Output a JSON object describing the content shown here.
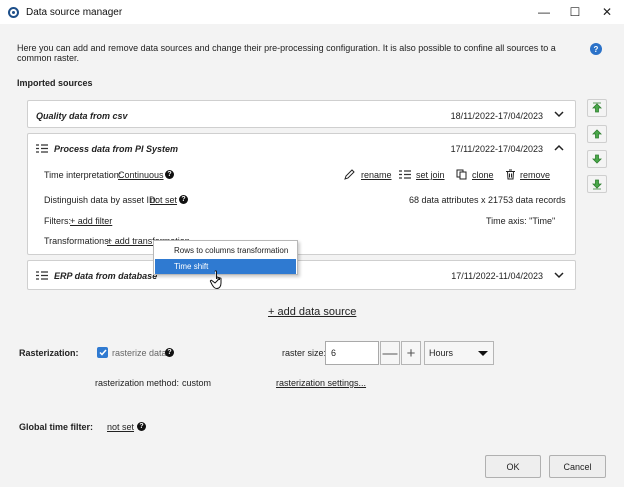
{
  "window": {
    "title": "Data source manager",
    "minimize_glyph": "—",
    "maximize_glyph": "☐",
    "close_glyph": "✕"
  },
  "intro": {
    "text": "Here you can add and remove data sources and change their pre-processing configuration. It is also possible to confine all sources to a common raster.",
    "help_glyph": "?"
  },
  "imported_sources_label": "Imported sources",
  "sources": [
    {
      "title": "Quality data from csv",
      "date_range": "18/11/2022-17/04/2023",
      "expanded": false
    },
    {
      "title": "Process data from PI System",
      "date_range": "17/11/2022-17/04/2023",
      "expanded": true,
      "time_interpretation_label": "Time interpretation:",
      "time_interpretation_value": "Continuous",
      "actions": {
        "rename": "rename",
        "set_join": "set join",
        "clone": "clone",
        "remove": "remove"
      },
      "asset_id_label": "Distinguish data by asset ID:",
      "asset_id_value": "not set",
      "records_info": "68 data attributes x 21753 data records",
      "filters_label": "Filters:",
      "add_filter": "+ add filter",
      "time_axis": "Time axis:  \"Time\"",
      "transformations_label": "Transformations:",
      "add_transformation": "+ add transformation"
    },
    {
      "title": "ERP data from database",
      "date_range": "17/11/2022-11/04/2023",
      "expanded": false
    }
  ],
  "context_menu": {
    "items": [
      {
        "label": "Rows to columns transformation",
        "highlighted": false
      },
      {
        "label": "Time shift",
        "highlighted": true
      }
    ]
  },
  "add_data_source": "+ add data source",
  "rasterization": {
    "label": "Rasterization:",
    "checkbox_label": "rasterize data",
    "checked": true,
    "raster_size_label": "raster size:",
    "raster_size_value": "6",
    "minus_glyph": "—",
    "plus_glyph": "+",
    "unit_selected": "Hours",
    "method_label": "rasterization method:",
    "method_value": "custom",
    "settings_link": "rasterization settings..."
  },
  "global_time_filter": {
    "label": "Global time filter:",
    "value": "not set"
  },
  "buttons": {
    "ok": "OK",
    "cancel": "Cancel"
  },
  "colors": {
    "accent": "#2f7ad1",
    "arrow_green": "#3e9a3e",
    "help_blue": "#2b72c8"
  },
  "icons": [
    "app-icon",
    "help-icon",
    "list-icon",
    "chevron-down-icon",
    "chevron-up-icon",
    "pencil-icon",
    "join-icon",
    "clone-icon",
    "trash-icon",
    "arrow-top-icon",
    "arrow-up-icon",
    "arrow-down-icon",
    "arrow-bottom-icon",
    "check-icon",
    "hand-cursor-icon"
  ]
}
